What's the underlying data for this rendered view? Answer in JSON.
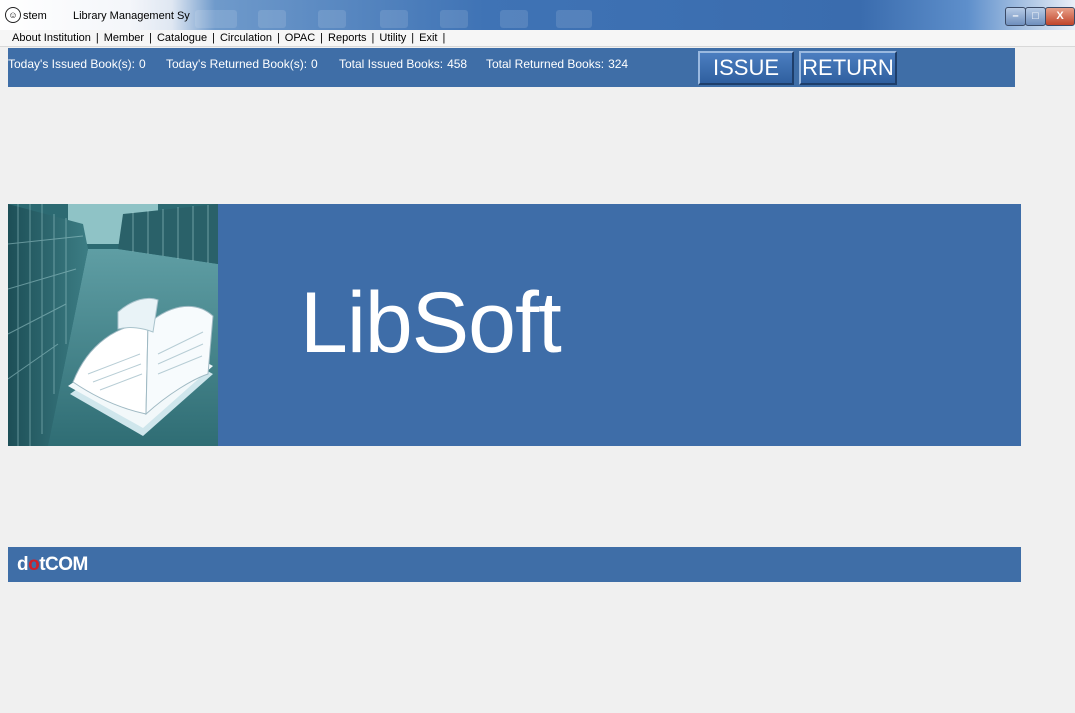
{
  "window": {
    "title_left": "stem",
    "title_right": "Library Management Sy",
    "minimize_glyph": "–",
    "maximize_glyph": "□",
    "close_glyph": "X"
  },
  "menu": {
    "items": [
      {
        "label": "About Institution"
      },
      {
        "label": "Member"
      },
      {
        "label": "Catalogue"
      },
      {
        "label": "Circulation"
      },
      {
        "label": "OPAC"
      },
      {
        "label": "Reports"
      },
      {
        "label": "Utility"
      },
      {
        "label": "Exit"
      }
    ]
  },
  "status": {
    "todays_issued_label": "Today's Issued Book(s):",
    "todays_issued_value": "0",
    "todays_returned_label": "Today's Returned Book(s):",
    "todays_returned_value": "0",
    "total_issued_label": "Total Issued Books:",
    "total_issued_value": "458",
    "total_returned_label": "Total Returned Books:",
    "total_returned_value": "324"
  },
  "actions": {
    "issue_label": "ISSUE",
    "return_label": "RETURN"
  },
  "banner": {
    "brand": "LibSoft",
    "image_icon": "library-book-photo"
  },
  "footer": {
    "company_part1": "d",
    "company_part2": "o",
    "company_part3": "tCOM"
  },
  "colors": {
    "panel_blue": "#3f6ea7",
    "banner_blue": "#3e6da8",
    "background": "#f0f0f0",
    "brand_red": "#d0202a"
  }
}
